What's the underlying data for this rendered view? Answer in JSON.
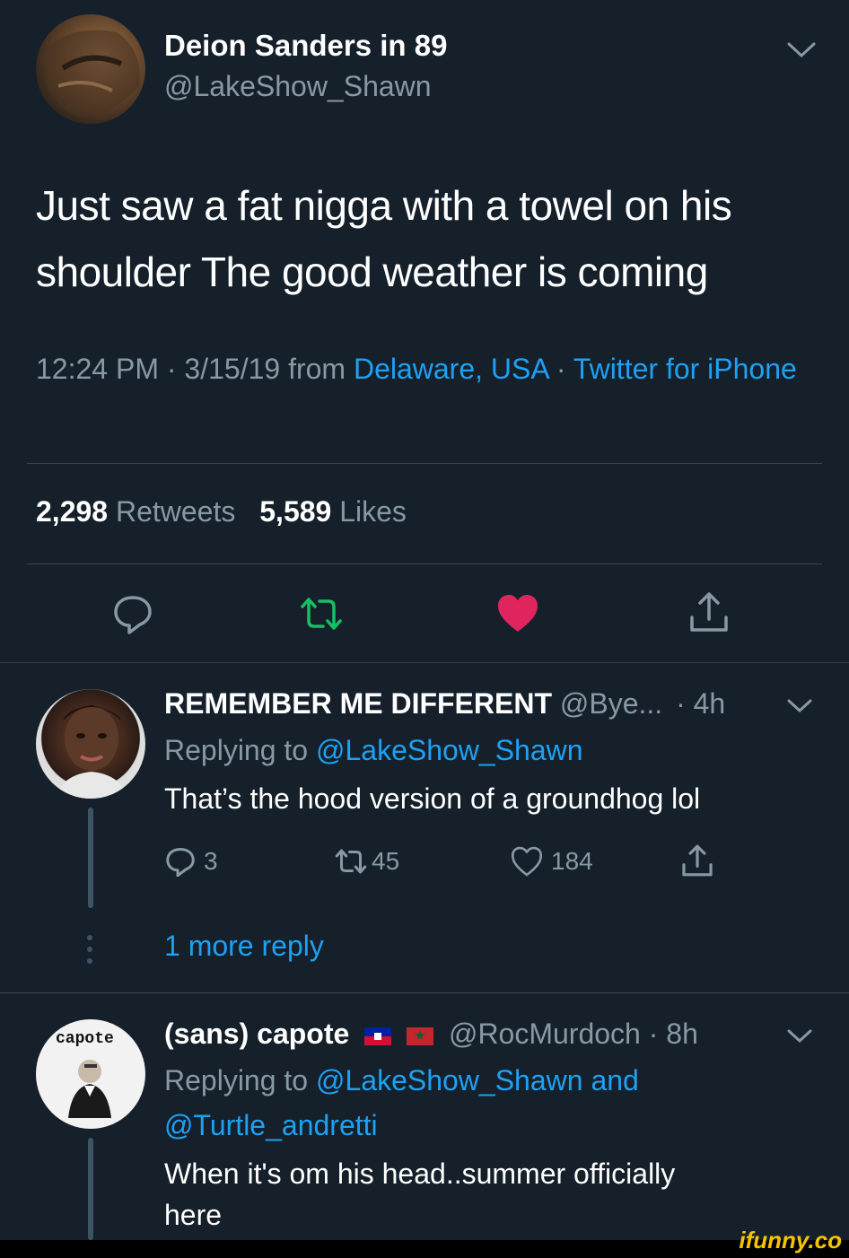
{
  "tweet": {
    "display_name": "Deion Sanders in 89",
    "handle": "@LakeShow_Shawn",
    "text": "Just saw a fat nigga with a towel on his shoulder The good weather is coming",
    "time": "12:24 PM · 3/15/19 from ",
    "location": "Delaware, USA",
    "separator": " · ",
    "source": "Twitter for iPhone",
    "retweet_count": "2,298",
    "retweet_label": "Retweets",
    "like_count": "5,589",
    "like_label": "Likes"
  },
  "replies": [
    {
      "name": "REMEMBER ME DIFFERENT",
      "handle": "@Bye...",
      "time": "· 4h",
      "replying_prefix": "Replying to ",
      "replying_to": "@LakeShow_Shawn",
      "text": "That’s the hood version of a groundhog lol",
      "reply_count": "3",
      "retweet_count": "45",
      "like_count": "184",
      "more_replies": "1 more reply"
    },
    {
      "name": "(sans) capote",
      "handle": "@RocMurdoch",
      "time": "· 8h",
      "replying_prefix": "Replying to ",
      "replying_to": "@LakeShow_Shawn and",
      "replying_to_2": "@Turtle_andretti",
      "text_line1": "When it's om his head..summer officially",
      "text_line2": "here",
      "avatar_text": "capote"
    }
  ],
  "watermark": "ifunny.co",
  "colors": {
    "background": "#15202b",
    "link": "#1da1f2",
    "muted": "#8899a6",
    "retweet_green": "#17bf63",
    "like_red": "#e0245e"
  }
}
